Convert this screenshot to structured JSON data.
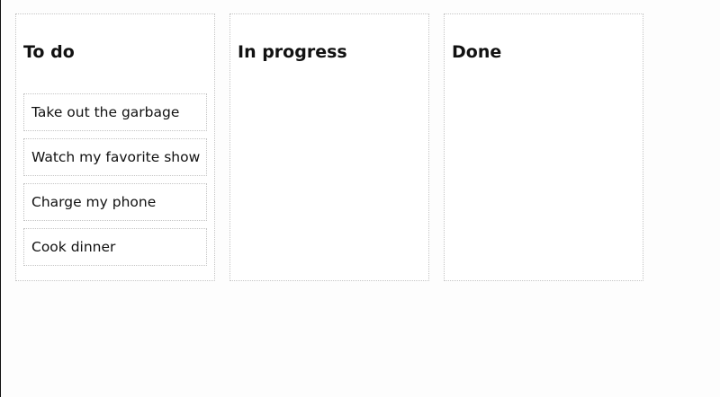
{
  "board": {
    "columns": [
      {
        "title": "To do",
        "cards": [
          "Take out the garbage",
          "Watch my favorite show",
          "Charge my phone",
          "Cook dinner"
        ]
      },
      {
        "title": "In progress",
        "cards": []
      },
      {
        "title": "Done",
        "cards": []
      }
    ]
  }
}
